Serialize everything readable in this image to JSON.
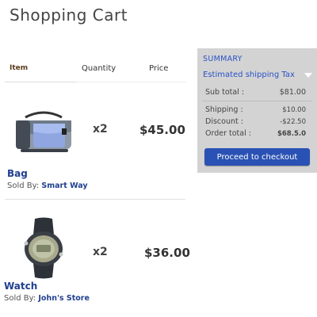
{
  "page": {
    "title": "Shopping Cart"
  },
  "cart": {
    "headers": {
      "item": "Item",
      "quantity": "Quantity",
      "price": "Price"
    },
    "items": [
      {
        "name": "Bag",
        "quantity": "x2",
        "price": "$45.00",
        "sold_by_label": "Sold By:",
        "seller": "Smart Way",
        "image_icon": "messenger-bag-icon"
      },
      {
        "name": "Watch",
        "quantity": "x2",
        "price": "$36.00",
        "sold_by_label": "Sold By:",
        "seller": "John's Store",
        "image_icon": "sport-watch-icon"
      }
    ]
  },
  "summary": {
    "title": "SUMMARY",
    "estimated_label": "Estimated shipping Tax",
    "sub_total_label": "Sub total :",
    "sub_total_value": "$81.00",
    "shipping_label": "Shipping :",
    "shipping_value": "$10.00",
    "discount_label": "Discount :",
    "discount_value": "-$22.50",
    "order_total_label": "Order total :",
    "order_total_value": "$68.5.0",
    "checkout_label": "Proceed to checkout"
  },
  "colors": {
    "accent": "#2a52b4",
    "link": "#1f3f8f",
    "summary_bg": "#d3d3d3"
  }
}
